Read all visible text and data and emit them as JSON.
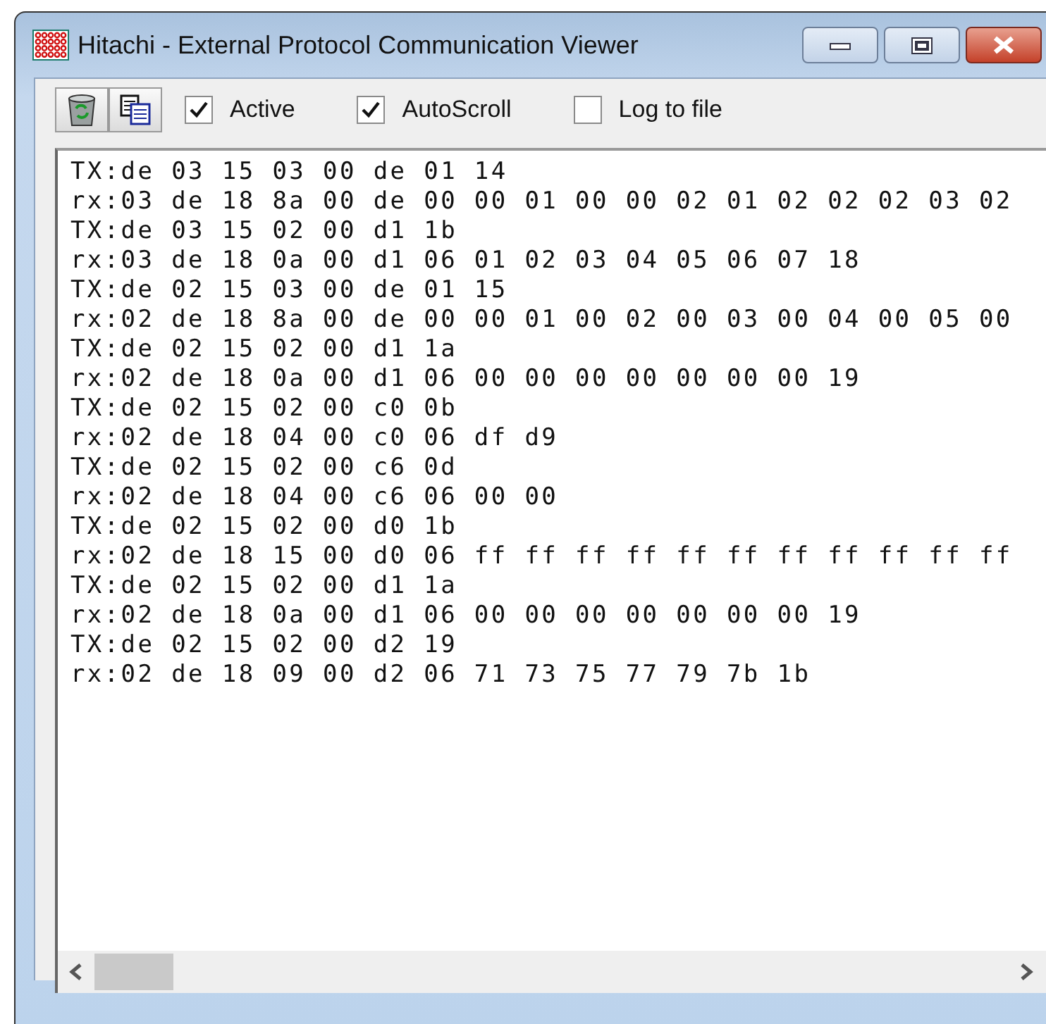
{
  "window": {
    "title": "Hitachi - External Protocol Communication Viewer"
  },
  "options": [
    {
      "label": "Active",
      "checked": true
    },
    {
      "label": "AutoScroll",
      "checked": true
    },
    {
      "label": "Log to file",
      "checked": false
    }
  ],
  "log": {
    "lines": [
      "TX:de 03 15 03 00 de 01 14",
      "rx:03 de 18 8a 00 de 00 00 01 00 00 02 01 02 02 02 03 02",
      "TX:de 03 15 02 00 d1 1b",
      "rx:03 de 18 0a 00 d1 06 01 02 03 04 05 06 07 18",
      "TX:de 02 15 03 00 de 01 15",
      "rx:02 de 18 8a 00 de 00 00 01 00 02 00 03 00 04 00 05 00",
      "TX:de 02 15 02 00 d1 1a",
      "rx:02 de 18 0a 00 d1 06 00 00 00 00 00 00 00 19",
      "TX:de 02 15 02 00 c0 0b",
      "rx:02 de 18 04 00 c0 06 df d9",
      "TX:de 02 15 02 00 c6 0d",
      "rx:02 de 18 04 00 c6 06 00 00",
      "TX:de 02 15 02 00 d0 1b",
      "rx:02 de 18 15 00 d0 06 ff ff ff ff ff ff ff ff ff ff ff",
      "TX:de 02 15 02 00 d1 1a",
      "rx:02 de 18 0a 00 d1 06 00 00 00 00 00 00 00 19",
      "TX:de 02 15 02 00 d2 19",
      "rx:02 de 18 09 00 d2 06 71 73 75 77 79 7b 1b"
    ]
  }
}
